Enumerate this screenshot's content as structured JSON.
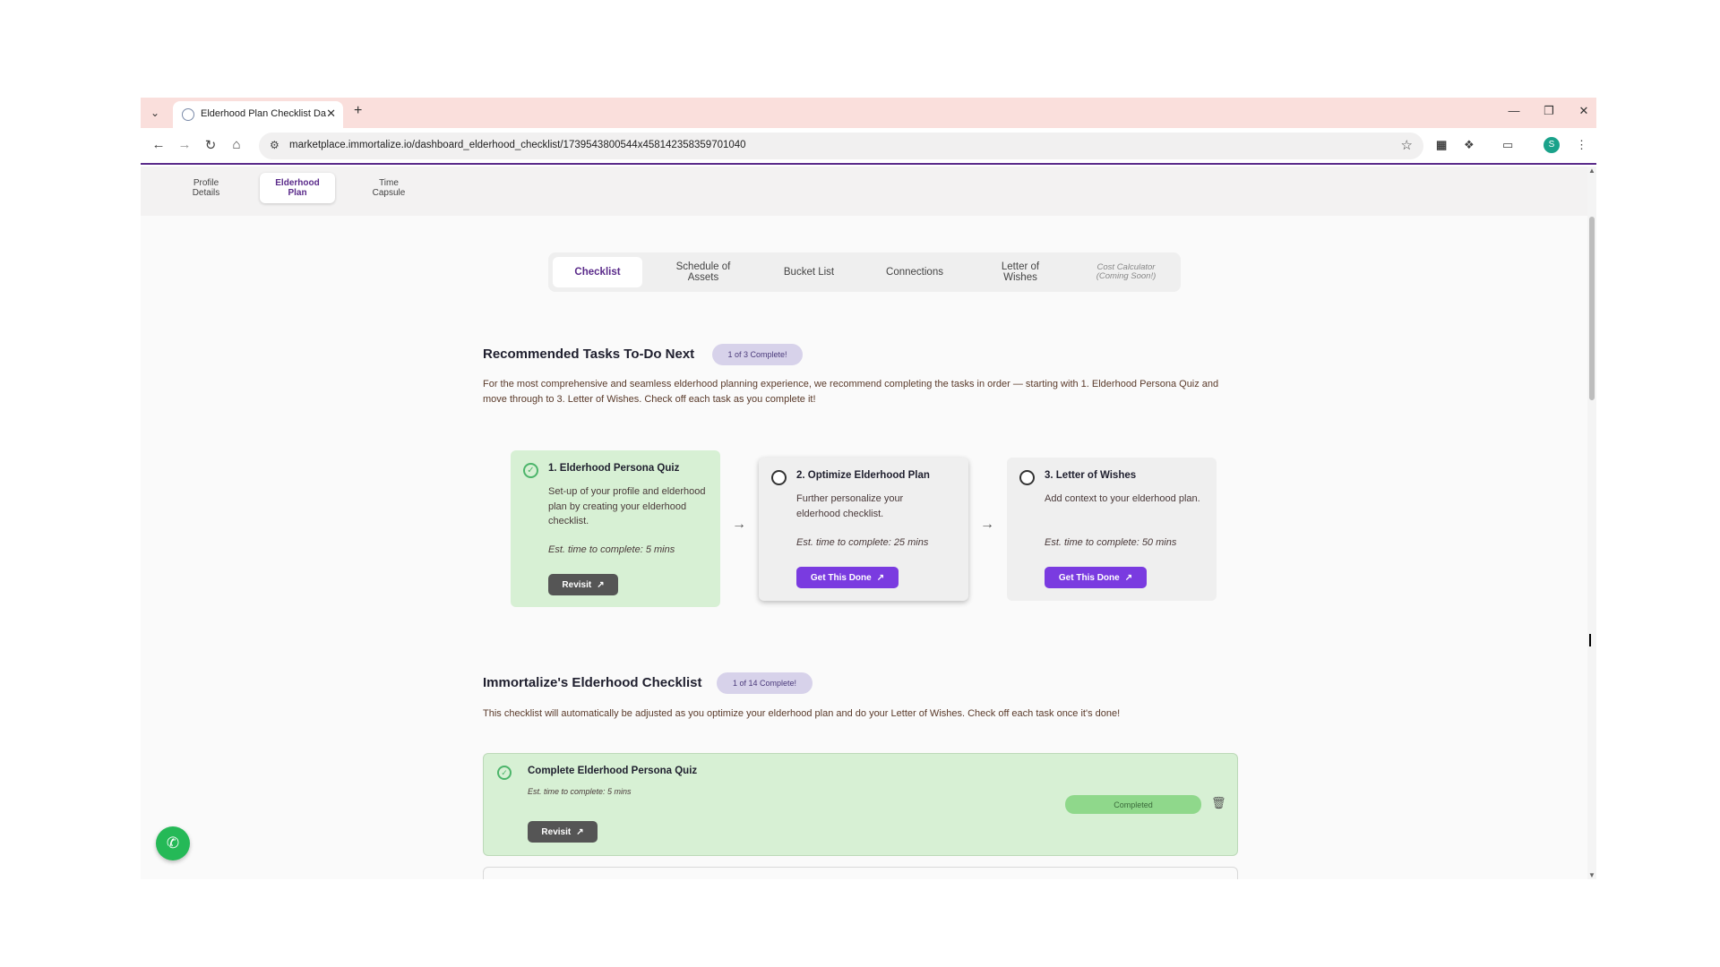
{
  "browser": {
    "tab_title": "Elderhood Plan Checklist Dashb",
    "url": "marketplace.immortalize.io/dashboard_elderhood_checklist/1739543800544x458142358359701040",
    "profile_initial": "S"
  },
  "topnav": {
    "items": [
      {
        "label_line1": "Profile",
        "label_line2": "Details"
      },
      {
        "label_line1": "Elderhood",
        "label_line2": "Plan"
      },
      {
        "label_line1": "Time",
        "label_line2": "Capsule"
      }
    ]
  },
  "subtabs": {
    "checklist": "Checklist",
    "schedule_line1": "Schedule of",
    "schedule_line2": "Assets",
    "bucket_list": "Bucket List",
    "connections": "Connections",
    "letter_line1": "Letter of",
    "letter_line2": "Wishes",
    "cost_line1": "Cost Calculator",
    "cost_line2": "(Coming Soon!)"
  },
  "recommended": {
    "title": "Recommended Tasks To-Do Next",
    "badge": "1 of 3 Complete!",
    "description": "For the most comprehensive and seamless elderhood planning experience, we recommend completing the tasks in order — starting with 1. Elderhood Persona Quiz and move through to 3. Letter of Wishes. Check off each task as you complete it!",
    "tasks": [
      {
        "title": "1. Elderhood Persona Quiz",
        "description": "Set-up of your profile and elderhood plan by creating your elderhood checklist.",
        "estimate": "Est. time to complete: 5 mins",
        "button": "Revisit"
      },
      {
        "title": "2. Optimize Elderhood Plan",
        "description": "Further personalize your elderhood checklist.",
        "estimate": "Est. time to complete: 25 mins",
        "button": "Get This Done"
      },
      {
        "title": "3. Letter of Wishes",
        "description": "Add context to your elderhood plan.",
        "estimate": "Est. time to complete: 50 mins",
        "button": "Get This Done"
      }
    ]
  },
  "checklist": {
    "title": "Immortalize's Elderhood Checklist",
    "badge": "1 of 14 Complete!",
    "description": "This checklist will automatically be adjusted as you optimize your elderhood plan and do your Letter of Wishes. Check off each task once it's done!",
    "items": [
      {
        "title": "Complete Elderhood Persona Quiz",
        "estimate": "Est. time to complete: 5 mins",
        "button": "Revisit",
        "status": "Completed"
      }
    ]
  },
  "colors": {
    "accent_purple": "#7a3be0",
    "done_green": "#d7f0d4",
    "status_green": "#8fd88b",
    "whatsapp_green": "#25b957"
  },
  "icons": [
    "tab-list-icon",
    "favicon-icon",
    "close-icon",
    "plus-icon",
    "minimize-icon",
    "restore-icon",
    "back-icon",
    "forward-icon",
    "reload-icon",
    "home-icon",
    "site-settings-icon",
    "star-icon",
    "extension-icon",
    "cast-icon",
    "menu-icon",
    "check-circle-icon",
    "external-link-icon",
    "arrow-right-icon",
    "trash-icon",
    "whatsapp-icon"
  ]
}
